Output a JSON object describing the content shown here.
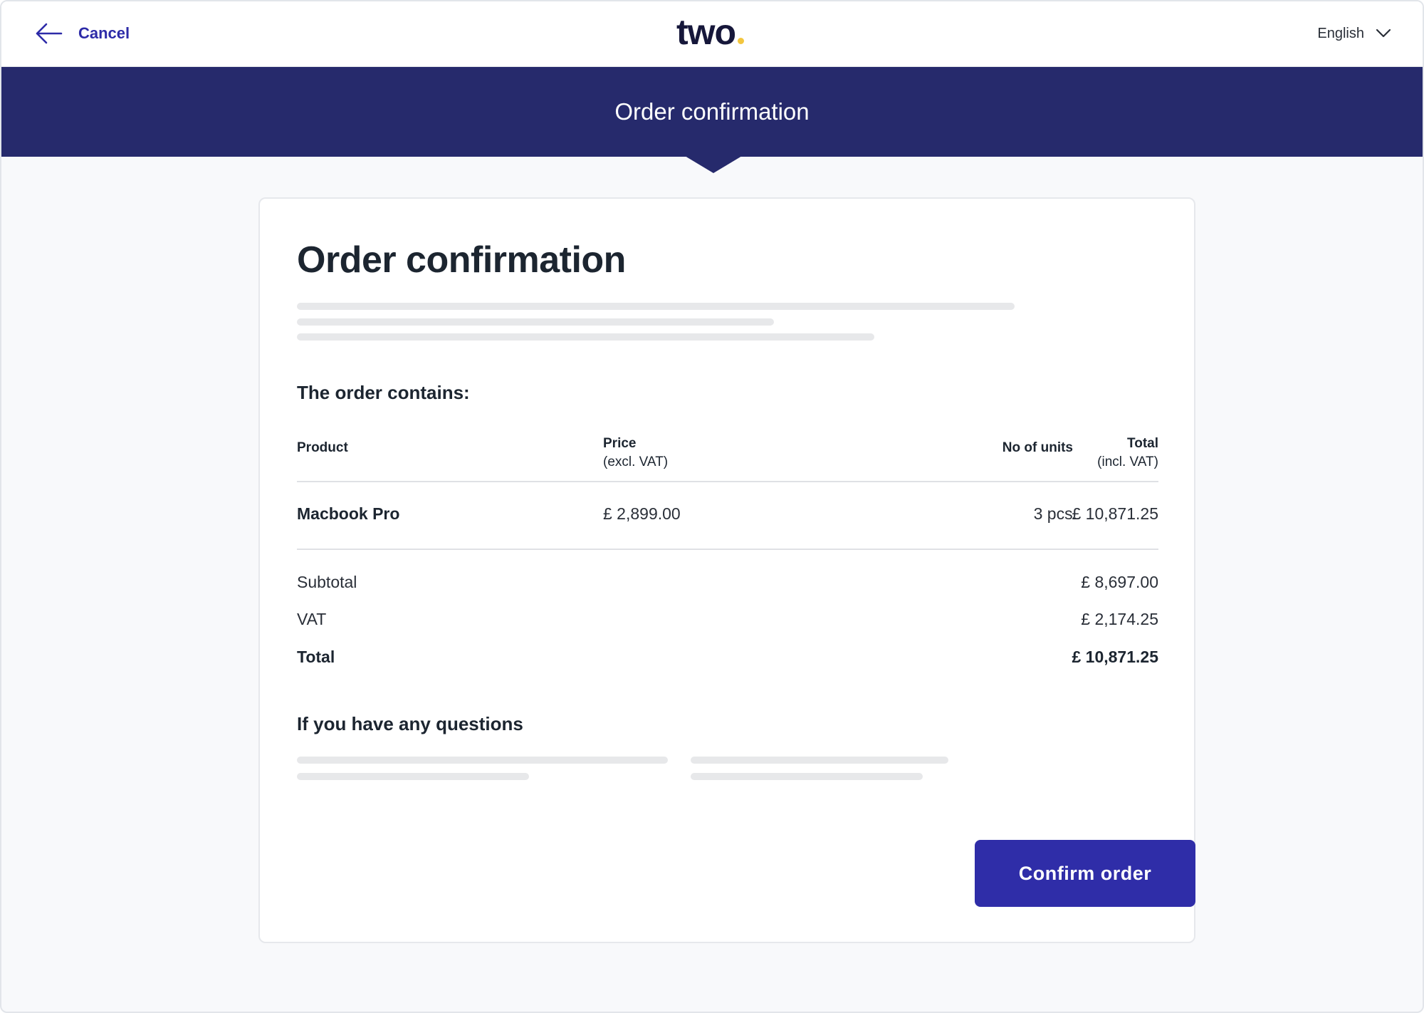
{
  "header": {
    "cancel_label": "Cancel",
    "logo_text": "two",
    "language": "English"
  },
  "banner": {
    "title": "Order confirmation"
  },
  "card": {
    "title": "Order confirmation",
    "order_heading": "The order contains:",
    "table": {
      "columns": [
        {
          "label": "Product",
          "sub": ""
        },
        {
          "label": "Price",
          "sub": "(excl. VAT)"
        },
        {
          "label": "No of units",
          "sub": ""
        },
        {
          "label": "Total",
          "sub": "(incl. VAT)"
        }
      ],
      "rows": [
        {
          "product": "Macbook Pro",
          "price": "£ 2,899.00",
          "units": "3 pcs.",
          "total": "£ 10,871.25"
        }
      ]
    },
    "summary": {
      "subtotal_label": "Subtotal",
      "subtotal_value": "£ 8,697.00",
      "vat_label": "VAT",
      "vat_value": "£ 2,174.25",
      "total_label": "Total",
      "total_value": "£ 10,871.25"
    },
    "questions_heading": "If you have any questions",
    "confirm_label": "Confirm order"
  },
  "colors": {
    "banner": "#262a6c",
    "accent": "#2f2da8",
    "logo_dot": "#f3c63f"
  }
}
